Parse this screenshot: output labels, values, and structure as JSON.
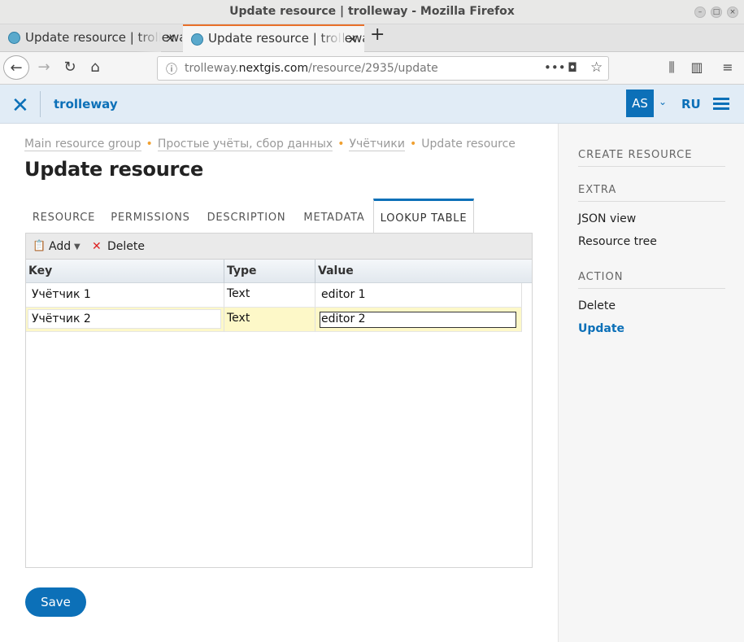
{
  "window": {
    "title": "Update resource | trolleway - Mozilla Firefox"
  },
  "tabs": [
    {
      "label": "Update resource | trolleway"
    },
    {
      "label": "Update resource | trolleway"
    }
  ],
  "addressbar": {
    "url_prefix": "trolleway.",
    "url_domain": "nextgis.com",
    "url_path": "/resource/2935/update"
  },
  "app": {
    "name": "trolleway",
    "avatar": "AS",
    "lang": "RU",
    "brand_color": "#0c70b8"
  },
  "breadcrumbs": [
    "Main resource group",
    "Простые учёты, сбор данных",
    "Учётчики",
    "Update resource"
  ],
  "page": {
    "title": "Update resource"
  },
  "resource_tabs": [
    "RESOURCE",
    "PERMISSIONS",
    "DESCRIPTION",
    "METADATA",
    "LOOKUP TABLE"
  ],
  "toolbar": {
    "add": "Add",
    "delete": "Delete"
  },
  "grid": {
    "columns": [
      "Key",
      "Type",
      "Value"
    ],
    "rows": [
      {
        "key": "Учётчик 1",
        "type": "Text",
        "value": "editor 1"
      },
      {
        "key": "Учётчик 2",
        "type": "Text",
        "value": "editor 2"
      }
    ]
  },
  "save_label": "Save",
  "sidebar": {
    "create": "CREATE RESOURCE",
    "extra": "EXTRA",
    "extra_items": [
      "JSON view",
      "Resource tree"
    ],
    "action": "ACTION",
    "action_items": [
      "Delete",
      "Update"
    ]
  }
}
